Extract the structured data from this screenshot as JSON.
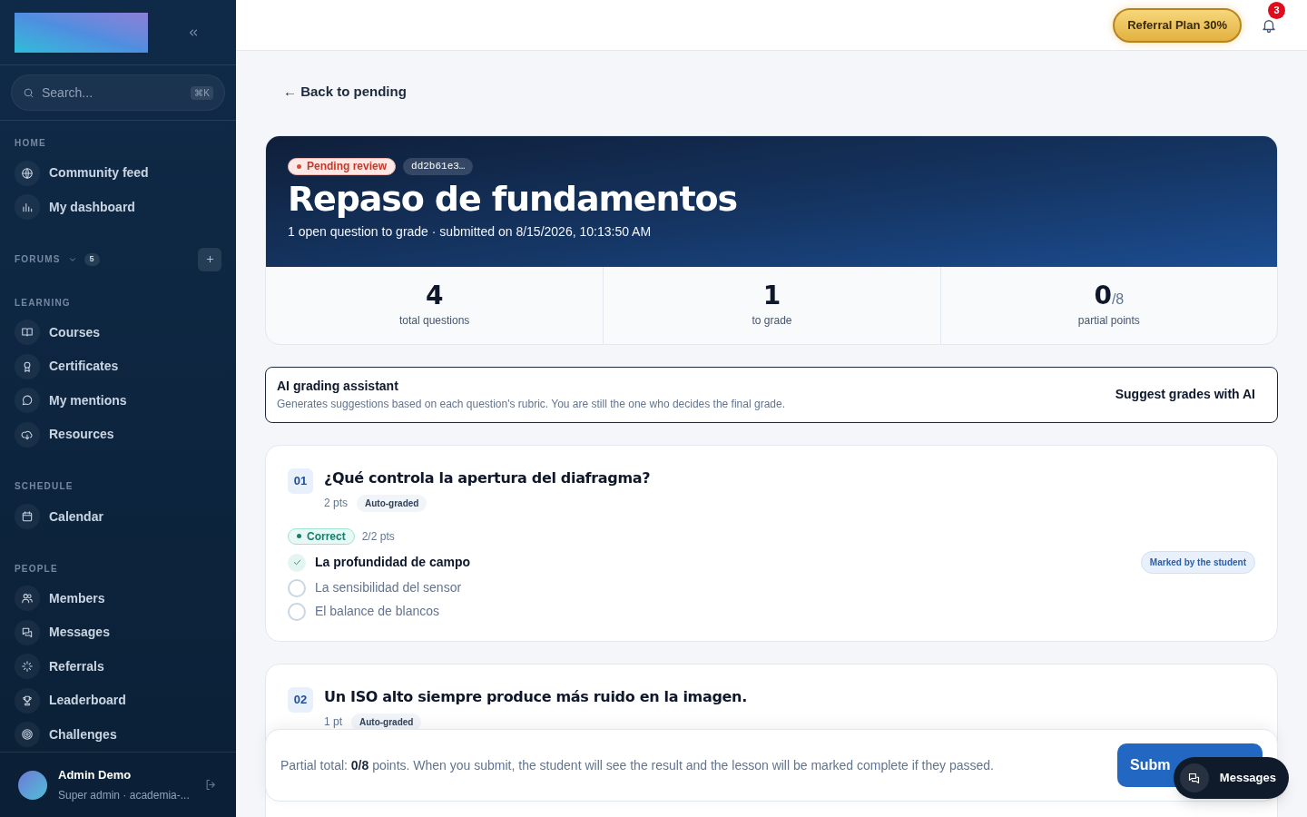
{
  "sidebar": {
    "search": {
      "placeholder": "Search...",
      "shortcut": "⌘K"
    },
    "sections": [
      {
        "label": "HOME",
        "items": [
          {
            "label": "Community feed"
          },
          {
            "label": "My dashboard"
          }
        ]
      },
      {
        "label": "FORUMS",
        "count": "5"
      },
      {
        "label": "LEARNING",
        "items": [
          {
            "label": "Courses"
          },
          {
            "label": "Certificates"
          },
          {
            "label": "My mentions"
          },
          {
            "label": "Resources"
          }
        ]
      },
      {
        "label": "SCHEDULE",
        "items": [
          {
            "label": "Calendar"
          }
        ]
      },
      {
        "label": "PEOPLE",
        "items": [
          {
            "label": "Members"
          },
          {
            "label": "Messages"
          },
          {
            "label": "Referrals"
          },
          {
            "label": "Leaderboard"
          },
          {
            "label": "Challenges"
          }
        ]
      }
    ],
    "user": {
      "name": "Admin Demo",
      "subtitle": "Super admin · academia-..."
    }
  },
  "header": {
    "referral_button": "Referral Plan 30%",
    "notification_count": "3"
  },
  "back_link": "← Back to pending",
  "submission": {
    "status": "Pending review",
    "id": "dd2b61e3…",
    "title": "Repaso de fundamentos",
    "subtitle": "1 open question to grade · submitted on 8/15/2026, 10:13:50 AM",
    "stats": [
      {
        "value": "4",
        "label": "total questions"
      },
      {
        "value": "1",
        "label": "to grade"
      },
      {
        "value": "0",
        "suffix": "/8",
        "label": "partial points"
      }
    ]
  },
  "ai_assistant": {
    "title": "AI grading assistant",
    "description": "Generates suggestions based on each question's rubric. You are still the one who decides the final grade.",
    "button": "Suggest grades with AI"
  },
  "questions": [
    {
      "number": "01",
      "title": "¿Qué controla la apertura del diafragma?",
      "points": "2 pts",
      "tag": "Auto-graded",
      "result": "Correct",
      "score": "2/2 pts",
      "options": [
        {
          "text": "La profundidad de campo",
          "selected": true,
          "note": "Marked by the student"
        },
        {
          "text": "La sensibilidad del sensor",
          "selected": false
        },
        {
          "text": "El balance de blancos",
          "selected": false
        }
      ]
    },
    {
      "number": "02",
      "title": "Un ISO alto siempre produce más ruido en la imagen.",
      "points": "1 pt",
      "tag": "Auto-graded"
    }
  ],
  "footer": {
    "text": "Partial total: **0/8** points. When you submit, the student will see the result and the lesson will be marked complete if they passed.",
    "button": "Subm"
  },
  "chat_button": "Messages"
}
